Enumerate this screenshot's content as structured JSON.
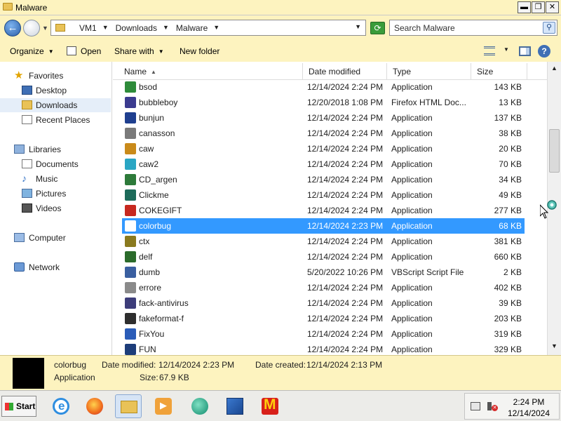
{
  "window": {
    "title": "Malware",
    "minimize_glyph": "▬",
    "maximize_glyph": "❐",
    "close_glyph": "✕"
  },
  "address": {
    "crumbs": [
      "VM1",
      "Downloads",
      "Malware"
    ],
    "search_placeholder": "Search Malware"
  },
  "toolbar": {
    "organize": "Organize",
    "open": "Open",
    "share_with": "Share with",
    "new_folder": "New folder"
  },
  "nav": {
    "favorites": "Favorites",
    "desktop": "Desktop",
    "downloads": "Downloads",
    "recent_places": "Recent Places",
    "libraries": "Libraries",
    "documents": "Documents",
    "music": "Music",
    "pictures": "Pictures",
    "videos": "Videos",
    "computer": "Computer",
    "network": "Network"
  },
  "columns": {
    "name": "Name",
    "date_modified": "Date modified",
    "type": "Type",
    "size": "Size"
  },
  "files": [
    {
      "name": "bsod",
      "date": "12/14/2024 2:24 PM",
      "type": "Application",
      "size": "143 KB",
      "icon_color": "#2e8b3a"
    },
    {
      "name": "bubbleboy",
      "date": "12/20/2018 1:08 PM",
      "type": "Firefox HTML Doc...",
      "size": "13 KB",
      "icon_color": "#3b3b8f"
    },
    {
      "name": "bunjun",
      "date": "12/14/2024 2:24 PM",
      "type": "Application",
      "size": "137 KB",
      "icon_color": "#1f3f8f"
    },
    {
      "name": "canasson",
      "date": "12/14/2024 2:24 PM",
      "type": "Application",
      "size": "38 KB",
      "icon_color": "#7a7a7a"
    },
    {
      "name": "caw",
      "date": "12/14/2024 2:24 PM",
      "type": "Application",
      "size": "20 KB",
      "icon_color": "#c98a1a"
    },
    {
      "name": "caw2",
      "date": "12/14/2024 2:24 PM",
      "type": "Application",
      "size": "70 KB",
      "icon_color": "#2aa6c4"
    },
    {
      "name": "CD_argen",
      "date": "12/14/2024 2:24 PM",
      "type": "Application",
      "size": "34 KB",
      "icon_color": "#2d7a3a"
    },
    {
      "name": "Clickme",
      "date": "12/14/2024 2:24 PM",
      "type": "Application",
      "size": "49 KB",
      "icon_color": "#1d6b5a"
    },
    {
      "name": "COKEGIFT",
      "date": "12/14/2024 2:24 PM",
      "type": "Application",
      "size": "277 KB",
      "icon_color": "#c7281f"
    },
    {
      "name": "colorbug",
      "date": "12/14/2024 2:23 PM",
      "type": "Application",
      "size": "68 KB",
      "icon_color": "#3399ff",
      "selected": true
    },
    {
      "name": "ctx",
      "date": "12/14/2024 2:24 PM",
      "type": "Application",
      "size": "381 KB",
      "icon_color": "#8a7a1f"
    },
    {
      "name": "delf",
      "date": "12/14/2024 2:24 PM",
      "type": "Application",
      "size": "660 KB",
      "icon_color": "#2b6b2b"
    },
    {
      "name": "dumb",
      "date": "5/20/2022 10:26 PM",
      "type": "VBScript Script File",
      "size": "2 KB",
      "icon_color": "#3a5fa0"
    },
    {
      "name": "errore",
      "date": "12/14/2024 2:24 PM",
      "type": "Application",
      "size": "402 KB",
      "icon_color": "#8a8a8a"
    },
    {
      "name": "fack-antivirus",
      "date": "12/14/2024 2:24 PM",
      "type": "Application",
      "size": "39 KB",
      "icon_color": "#3d3d7a"
    },
    {
      "name": "fakeformat-f",
      "date": "12/14/2024 2:24 PM",
      "type": "Application",
      "size": "203 KB",
      "icon_color": "#2e2e2e"
    },
    {
      "name": "FixYou",
      "date": "12/14/2024 2:24 PM",
      "type": "Application",
      "size": "319 KB",
      "icon_color": "#2a5cb8"
    },
    {
      "name": "FUN",
      "date": "12/14/2024 2:24 PM",
      "type": "Application",
      "size": "329 KB",
      "icon_color": "#1d3d7a"
    }
  ],
  "details": {
    "name": "colorbug",
    "type": "Application",
    "modified_label": "Date modified:",
    "modified_value": "12/14/2024 2:23 PM",
    "size_label": "Size:",
    "size_value": "67.9 KB",
    "created_label": "Date created:",
    "created_value": "12/14/2024 2:13 PM"
  },
  "taskbar": {
    "start": "Start",
    "clock_time": "2:24 PM",
    "clock_date": "12/14/2024"
  }
}
